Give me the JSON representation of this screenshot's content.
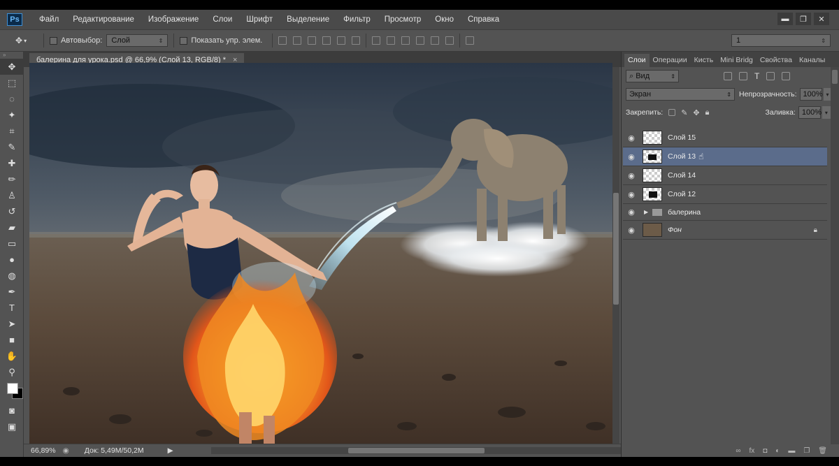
{
  "app": {
    "logo": "Ps"
  },
  "menu": [
    "Файл",
    "Редактирование",
    "Изображение",
    "Слои",
    "Шрифт",
    "Выделение",
    "Фильтр",
    "Просмотр",
    "Окно",
    "Справка"
  ],
  "window_controls": {
    "minimize": "▬",
    "maximize": "❐",
    "close": "✕"
  },
  "options": {
    "autoselect_label": "Автовыбор:",
    "autoselect_value": "Слой",
    "show_controls_label": "Показать упр. элем.",
    "right_value": "1"
  },
  "document": {
    "tab_title": "балерина для урока.psd @ 66,9% (Слой 13, RGB/8) *",
    "tab_close": "×"
  },
  "status": {
    "zoom": "66,89%",
    "doc": "Док: 5,49M/50,2M"
  },
  "panel": {
    "tabs": [
      "Слои",
      "Операции",
      "Кисть",
      "Mini Bridg",
      "Свойства",
      "Каналы"
    ],
    "filter_label": "Вид",
    "blend_mode": "Экран",
    "opacity_label": "Непрозрачность:",
    "opacity_value": "100%",
    "lock_label": "Закрепить:",
    "fill_label": "Заливка:",
    "fill_value": "100%"
  },
  "layers": [
    {
      "name": "Слой 15",
      "selected": false
    },
    {
      "name": "Слой 13",
      "selected": true
    },
    {
      "name": "Слой 14",
      "selected": false
    },
    {
      "name": "Слой 12",
      "selected": false
    },
    {
      "name": "балерина",
      "selected": false,
      "group": true
    },
    {
      "name": "Фон",
      "selected": false,
      "locked": true
    }
  ],
  "icons": {
    "move": "move-tool-icon",
    "eye": "eye-icon",
    "folder": "folder-icon",
    "lock": "lock-icon"
  },
  "colors": {
    "selected_layer": "#5b6c8b",
    "panel_bg": "#535353",
    "menu_bg": "#4a4a4a"
  }
}
